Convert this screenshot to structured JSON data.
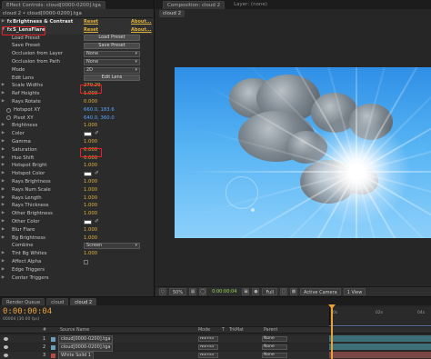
{
  "effect_panel": {
    "tab_label": "Effect Controls: cloud[0000-0200].tga",
    "tab_close": "≡",
    "subtitle": "cloud 2 • cloud[0000-0200].tga",
    "fx1": {
      "badge": "fx",
      "name": "Brightness & Contrast",
      "reset": "Reset",
      "about": "About..."
    },
    "fx2": {
      "badge": "fx",
      "name": "S_LensFlare",
      "reset": "Reset",
      "about": "About..."
    },
    "rows": [
      {
        "label": "Load Preset",
        "type": "button",
        "value": "Load Preset"
      },
      {
        "label": "Save Preset",
        "type": "button",
        "value": "Save Preset"
      },
      {
        "label": "Occlusion from Layer",
        "type": "dropdown",
        "value": "None"
      },
      {
        "label": "Occlusion from Path",
        "type": "dropdown",
        "value": "None"
      },
      {
        "label": "Mode",
        "type": "dropdown",
        "value": "2D"
      },
      {
        "label": "Edit Lens",
        "type": "button",
        "value": "Edit Lens"
      },
      {
        "label": "Scale Widths",
        "type": "value",
        "value": "279.29"
      },
      {
        "label": "Ref Heights",
        "type": "value",
        "value": "1.000"
      },
      {
        "label": "Rays Rotate",
        "type": "value",
        "value": "0.000"
      },
      {
        "label": "Hotspot XY",
        "type": "point",
        "value": "660.0, 183.6"
      },
      {
        "label": "Pivot XY",
        "type": "point",
        "value": "640.0, 360.0"
      },
      {
        "label": "Brightness",
        "type": "value",
        "value": "1.000"
      },
      {
        "label": "Color",
        "type": "color",
        "value": ""
      },
      {
        "label": "Gamma",
        "type": "value",
        "value": "1.000"
      },
      {
        "label": "Saturation",
        "type": "value",
        "value": "0.000"
      },
      {
        "label": "Hue Shift",
        "type": "value",
        "value": "0.000"
      },
      {
        "label": "Hotspot Bright",
        "type": "value",
        "value": "1.000"
      },
      {
        "label": "Hotspot Color",
        "type": "color",
        "value": ""
      },
      {
        "label": "Rays Brightness",
        "type": "value",
        "value": "1.000"
      },
      {
        "label": "Rays Num Scale",
        "type": "value",
        "value": "1.000"
      },
      {
        "label": "Rays Length",
        "type": "value",
        "value": "1.000"
      },
      {
        "label": "Rays Thickness",
        "type": "value",
        "value": "1.000"
      },
      {
        "label": "Other Brightness",
        "type": "value",
        "value": "1.000"
      },
      {
        "label": "Other Color",
        "type": "color",
        "value": ""
      },
      {
        "label": "Blur Flare",
        "type": "value",
        "value": "1.000"
      },
      {
        "label": "Bg Brightness",
        "type": "value",
        "value": "1.000"
      },
      {
        "label": "Combine",
        "type": "dropdown",
        "value": "Screen"
      },
      {
        "label": "Tint Bg Whites",
        "type": "value",
        "value": "1.000"
      },
      {
        "label": "Affect Alpha",
        "type": "checkbox",
        "value": ""
      },
      {
        "label": "Edge Triggers",
        "type": "group",
        "value": ""
      },
      {
        "label": "Center Triggers",
        "type": "group",
        "value": ""
      }
    ]
  },
  "comp_panel": {
    "tab_label": "Composition: cloud 2",
    "tab2_label": "Layer: (none)",
    "crumb": "cloud 2",
    "footer": {
      "zoom": "50%",
      "timecode": "0:00:00:04",
      "resolution": "Full",
      "camera": "Active Camera",
      "views": "1 View"
    }
  },
  "timeline": {
    "tabs": [
      "Render Queue",
      "cloud",
      "cloud 2"
    ],
    "timecode": "0:00:00:04",
    "fps": "00004 (30.00 fps)",
    "columns": {
      "num": "#",
      "source": "Source Name",
      "mode": "Mode",
      "t": "T",
      "trkmat": "TrkMat",
      "parent": "Parent"
    },
    "ruler": [
      "0s",
      "02s",
      "04s"
    ],
    "layers": [
      {
        "num": "1",
        "name": "cloud[0000-0200].tga",
        "mode": "Norma",
        "parent": "None",
        "chip": "#6f9fb8"
      },
      {
        "num": "2",
        "name": "cloud[0000-0200].tga",
        "mode": "Norma",
        "parent": "None",
        "chip": "#6f9fb8"
      },
      {
        "num": "3",
        "name": "White Solid 1",
        "mode": "Norma",
        "parent": "None",
        "chip": "#b84a4a"
      }
    ],
    "bar_colors": [
      "#3c6f78",
      "#3c6f78",
      "#7a4646"
    ]
  },
  "colors": {
    "accent_orange": "#e2b33d",
    "highlight_red": "#e8202a",
    "sky_blue": "#55b3f3"
  }
}
